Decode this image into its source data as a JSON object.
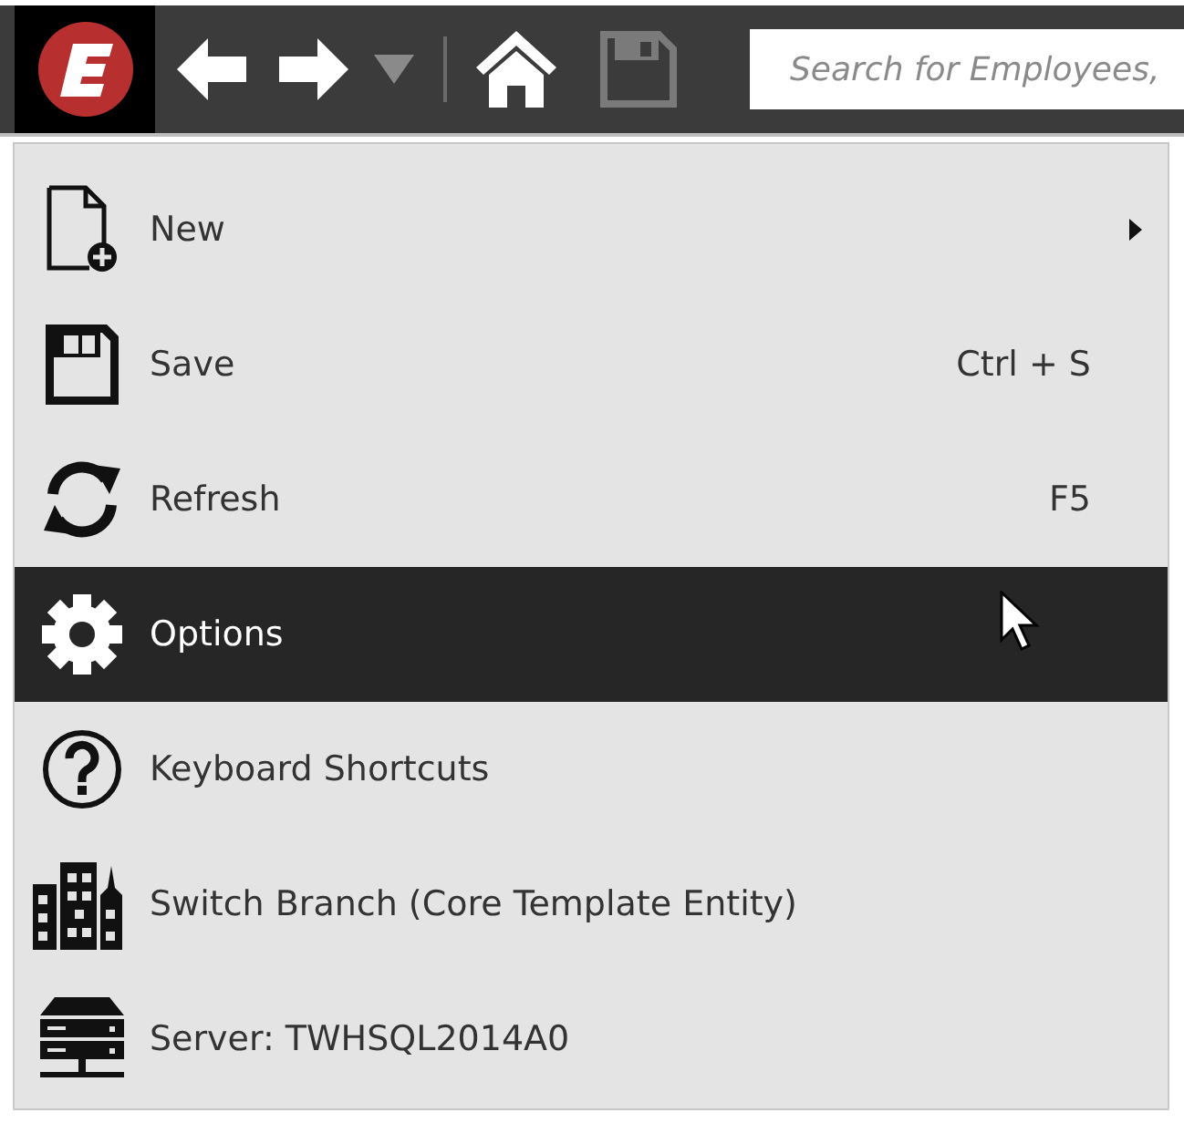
{
  "toolbar": {
    "search": {
      "placeholder": "Search for Employees,"
    },
    "history_dropdown": {
      "disabled": true
    },
    "save": {
      "disabled": true
    }
  },
  "menu": {
    "items": [
      {
        "label": "New",
        "submenu": true,
        "selected": false
      },
      {
        "label": "Save",
        "shortcut": "Ctrl + S",
        "submenu": false,
        "selected": false
      },
      {
        "label": "Refresh",
        "shortcut": "F5",
        "submenu": false,
        "selected": false
      },
      {
        "label": "Options",
        "submenu": false,
        "selected": true
      },
      {
        "label": "Keyboard Shortcuts",
        "submenu": false,
        "selected": false
      },
      {
        "label": "Switch Branch (Core Template Entity)",
        "submenu": false,
        "selected": false
      },
      {
        "label": "Server: TWHSQL2014A0",
        "submenu": false,
        "selected": false
      }
    ]
  }
}
